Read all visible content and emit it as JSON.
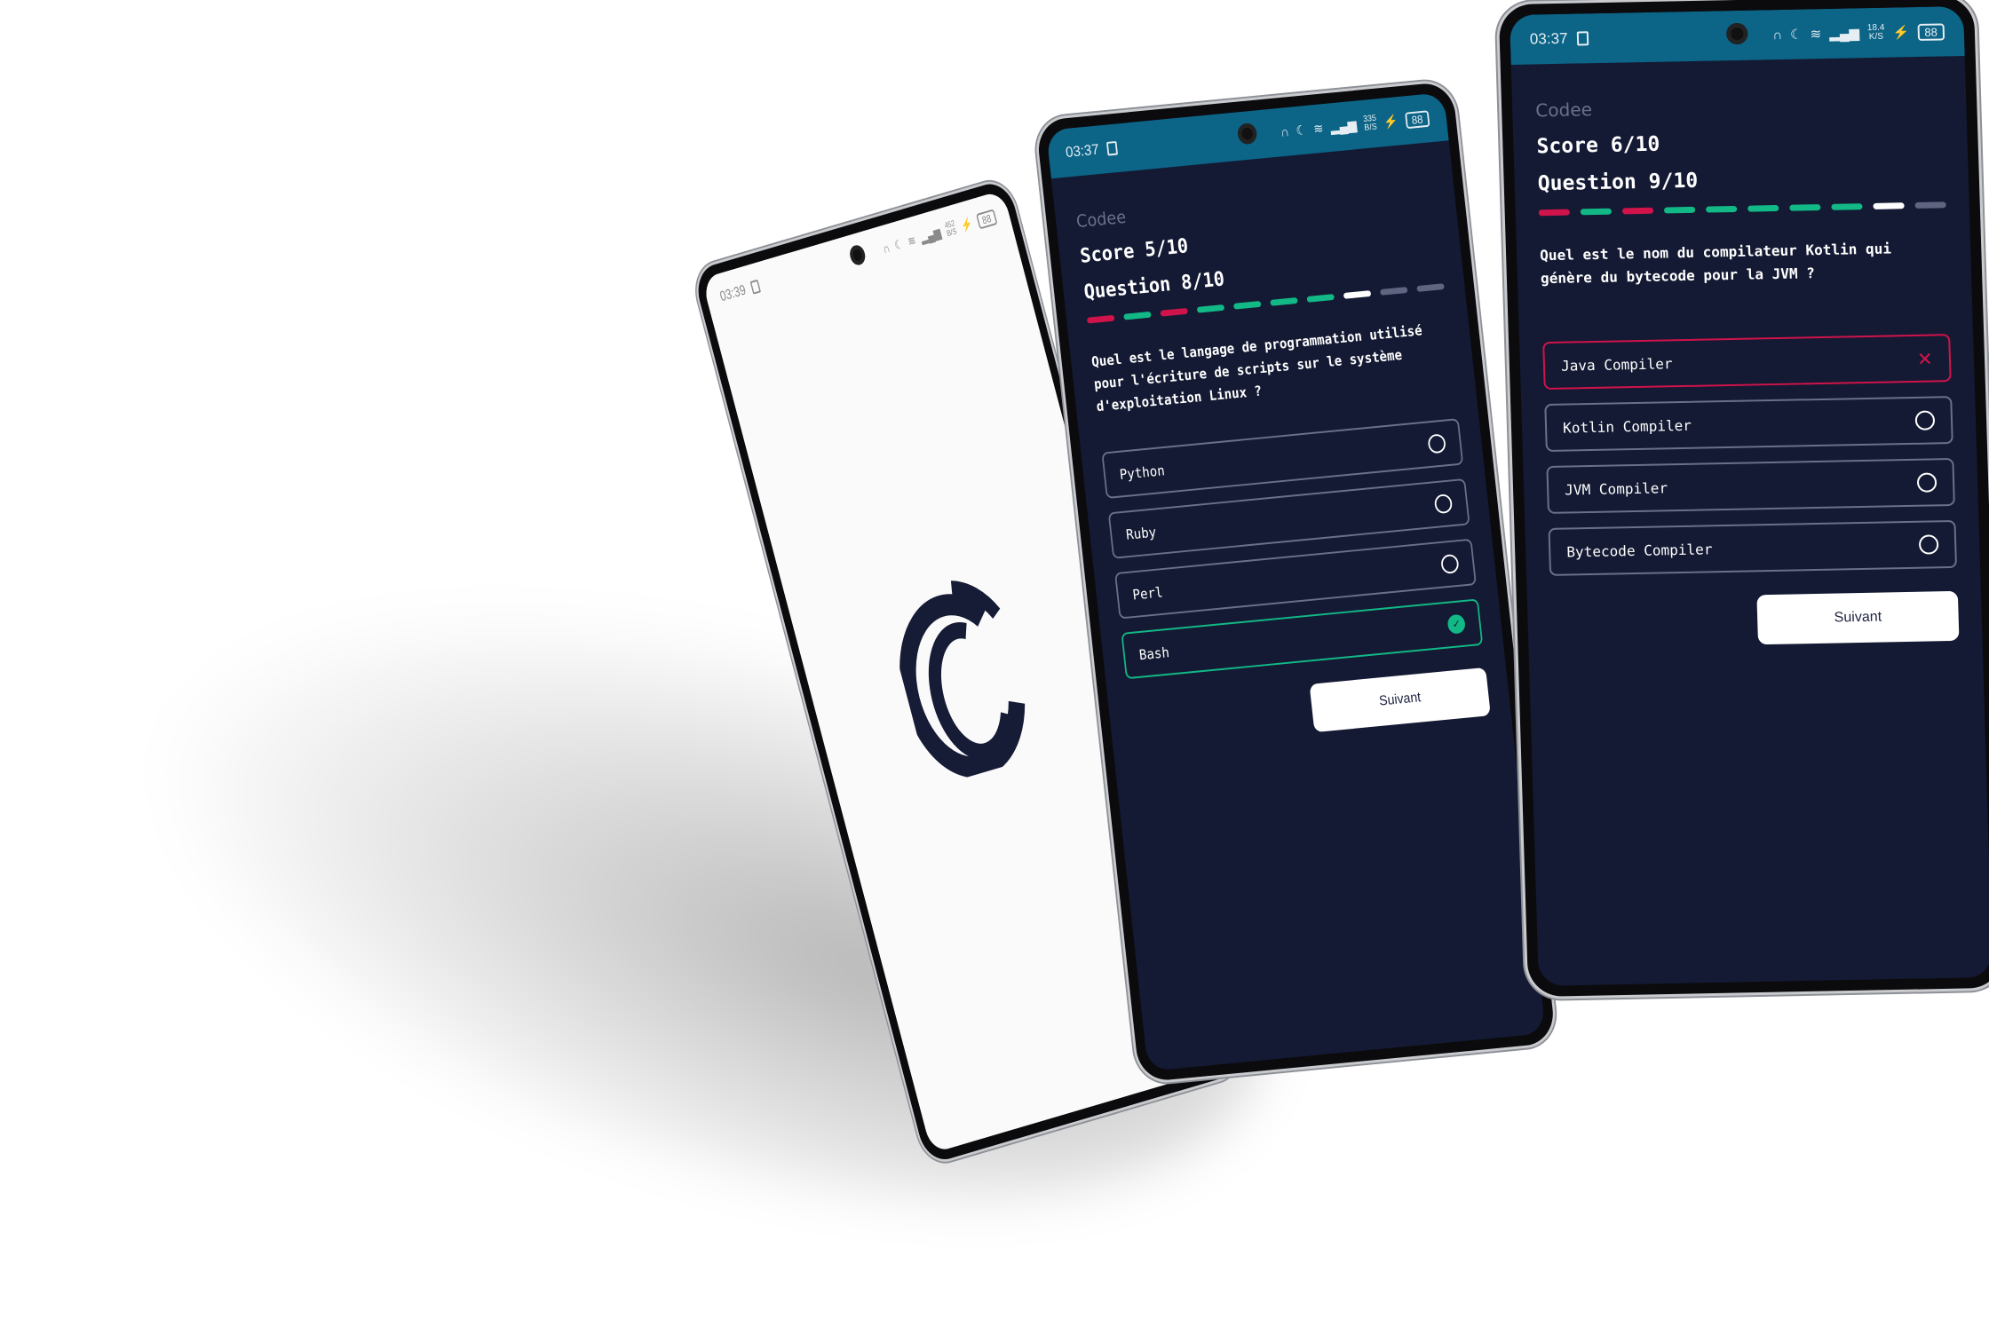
{
  "colors": {
    "background": "#141a33",
    "status_bar": "#0c6487",
    "correct": "#12b886",
    "wrong": "#d0134a",
    "current": "#ffffff",
    "pending": "#5f6480"
  },
  "splash": {
    "time": "03:39",
    "speed": "452",
    "speed_unit": "B/S",
    "battery": "88",
    "logo": "Codee"
  },
  "phones": [
    {
      "time": "03:37",
      "speed": "335",
      "speed_unit": "B/S",
      "battery": "88",
      "brand": "Codee",
      "score": "Score 5/10",
      "question_num": "Question 8/10",
      "progress": [
        "wrong",
        "correct",
        "wrong",
        "correct",
        "correct",
        "correct",
        "correct",
        "current",
        "pending",
        "pending"
      ],
      "question": "Quel est le langage de programmation utilisé pour l'écriture de scripts sur le système d'exploitation Linux ?",
      "options": [
        {
          "label": "Python",
          "state": "none"
        },
        {
          "label": "Ruby",
          "state": "none"
        },
        {
          "label": "Perl",
          "state": "none"
        },
        {
          "label": "Bash",
          "state": "correct"
        }
      ],
      "next_label": "Suivant"
    },
    {
      "time": "03:37",
      "speed": "18.4",
      "speed_unit": "K/S",
      "battery": "88",
      "brand": "Codee",
      "score": "Score 6/10",
      "question_num": "Question 9/10",
      "progress": [
        "wrong",
        "correct",
        "wrong",
        "correct",
        "correct",
        "correct",
        "correct",
        "correct",
        "current",
        "pending"
      ],
      "question": "Quel est le nom du compilateur Kotlin qui génère du bytecode pour la JVM ?",
      "options": [
        {
          "label": "Java Compiler",
          "state": "wrong"
        },
        {
          "label": "Kotlin Compiler",
          "state": "none"
        },
        {
          "label": "JVM Compiler",
          "state": "none"
        },
        {
          "label": "Bytecode Compiler",
          "state": "none"
        }
      ],
      "next_label": "Suivant"
    }
  ]
}
